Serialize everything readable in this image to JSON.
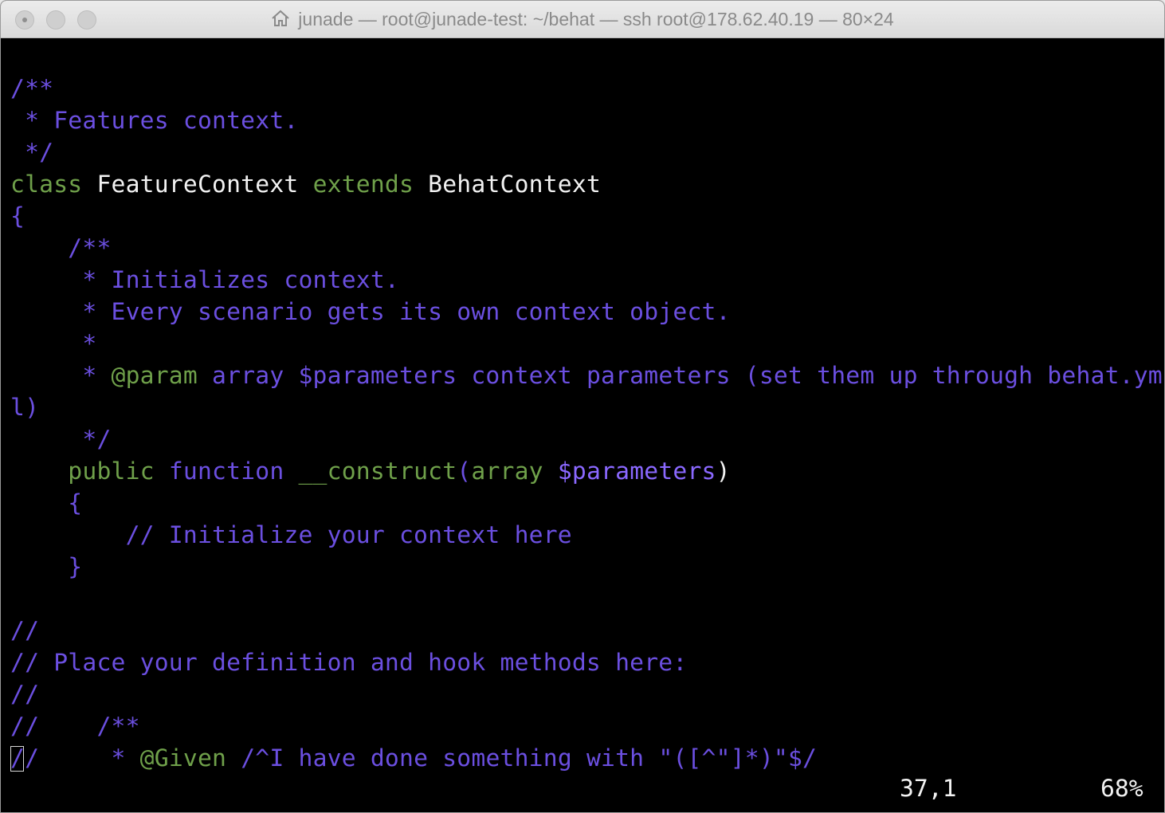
{
  "window": {
    "title": "junade — root@junade-test: ~/behat — ssh root@178.62.40.19 — 80×24"
  },
  "terminal": {
    "lines": {
      "l1": "/**",
      "l2": " * Features context.",
      "l3": " */",
      "l4_kw1": "class",
      "l4_name": " FeatureContext ",
      "l4_kw2": "extends",
      "l4_parent": " BehatContext",
      "l5": "{",
      "l6": "    /**",
      "l7": "     * Initializes context.",
      "l8": "     * Every scenario gets its own context object.",
      "l9": "     *",
      "l10_a": "     * ",
      "l10_param": "@param",
      "l10_b": " array $parameters context parameters (set them up through behat.ym",
      "l11": "l)",
      "l12": "     */",
      "l13_indent": "    ",
      "l13_public": "public",
      "l13_function": " function ",
      "l13_construct": "__construct",
      "l13_paren": "(",
      "l13_array": "array",
      "l13_var": " $parameters",
      "l13_close": ")",
      "l14": "    {",
      "l15": "        // Initialize your context here",
      "l16": "    }",
      "l17": "",
      "l18": "//",
      "l19": "// Place your definition and hook methods here:",
      "l20": "//",
      "l21": "//    /**",
      "l22_cursor": "/",
      "l22_a": "/     * ",
      "l22_given": "@Given",
      "l22_b": " /^I have done something with \"([^\"]*)\"$/"
    },
    "status_position": "37,1",
    "status_percent": "68%"
  },
  "colors": {
    "comment": "#6b4fe0",
    "keyword": "#6fa04a",
    "plain": "#f2f2f2",
    "background": "#000000"
  }
}
